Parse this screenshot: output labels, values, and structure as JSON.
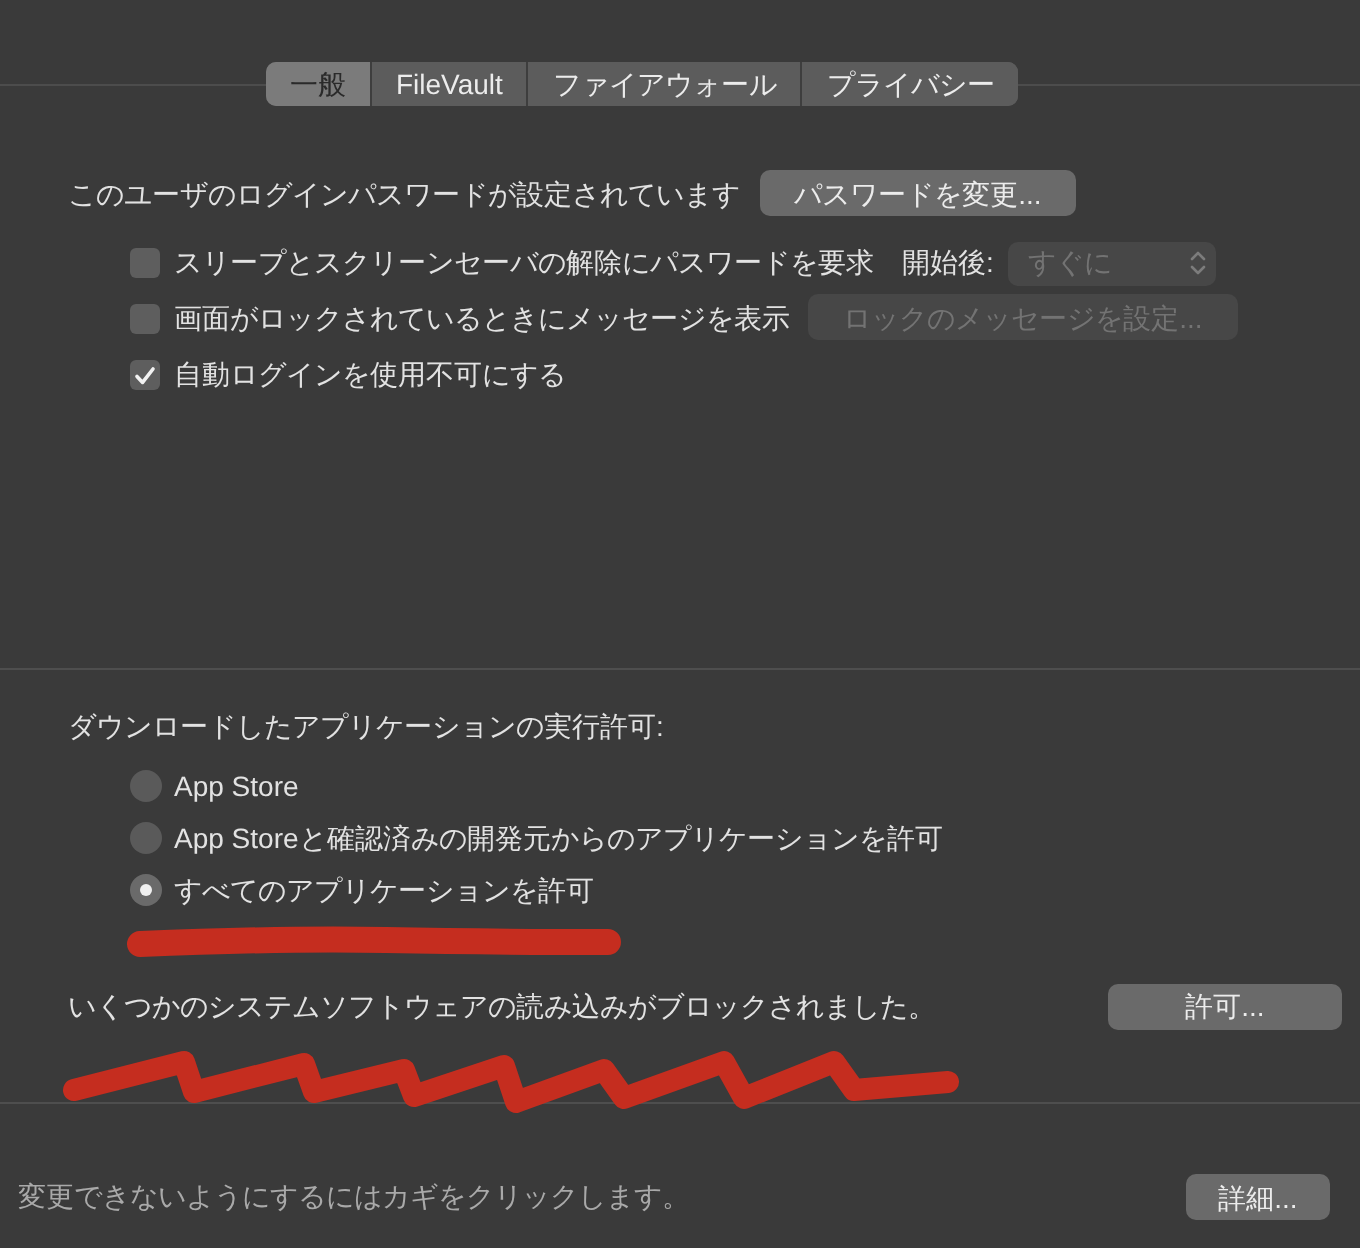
{
  "tabs": [
    {
      "label": "一般",
      "selected": true
    },
    {
      "label": "FileVault",
      "selected": false
    },
    {
      "label": "ファイアウォール",
      "selected": false
    },
    {
      "label": "プライバシー",
      "selected": false
    }
  ],
  "password": {
    "label": "このユーザのログインパスワードが設定されています",
    "button": "パスワードを変更..."
  },
  "options": [
    {
      "kind": "select",
      "label": "スリープとスクリーンセーバの解除にパスワードを要求",
      "checked": false,
      "select_label": "開始後:",
      "select": {
        "value": "すぐに",
        "disabled": true
      }
    },
    {
      "kind": "button",
      "label": "画面がロックされているときにメッセージを表示",
      "checked": false,
      "button": {
        "label": "ロックのメッセージを設定...",
        "disabled": true
      }
    },
    {
      "kind": "plain",
      "label": "自動ログインを使用不可にする",
      "checked": true
    }
  ],
  "downloads": {
    "heading": "ダウンロードしたアプリケーションの実行許可:",
    "options": [
      {
        "label": "App Store",
        "selected": false
      },
      {
        "label": "App Storeと確認済みの開発元からのアプリケーションを許可",
        "selected": false
      },
      {
        "label": "すべてのアプリケーションを許可",
        "selected": true
      }
    ]
  },
  "blocked": {
    "message": "いくつかのシステムソフトウェアの読み込みがブロックされました。",
    "button": "許可..."
  },
  "footer": {
    "message": "変更できないようにするにはカギをクリックします。",
    "button": "詳細..."
  }
}
